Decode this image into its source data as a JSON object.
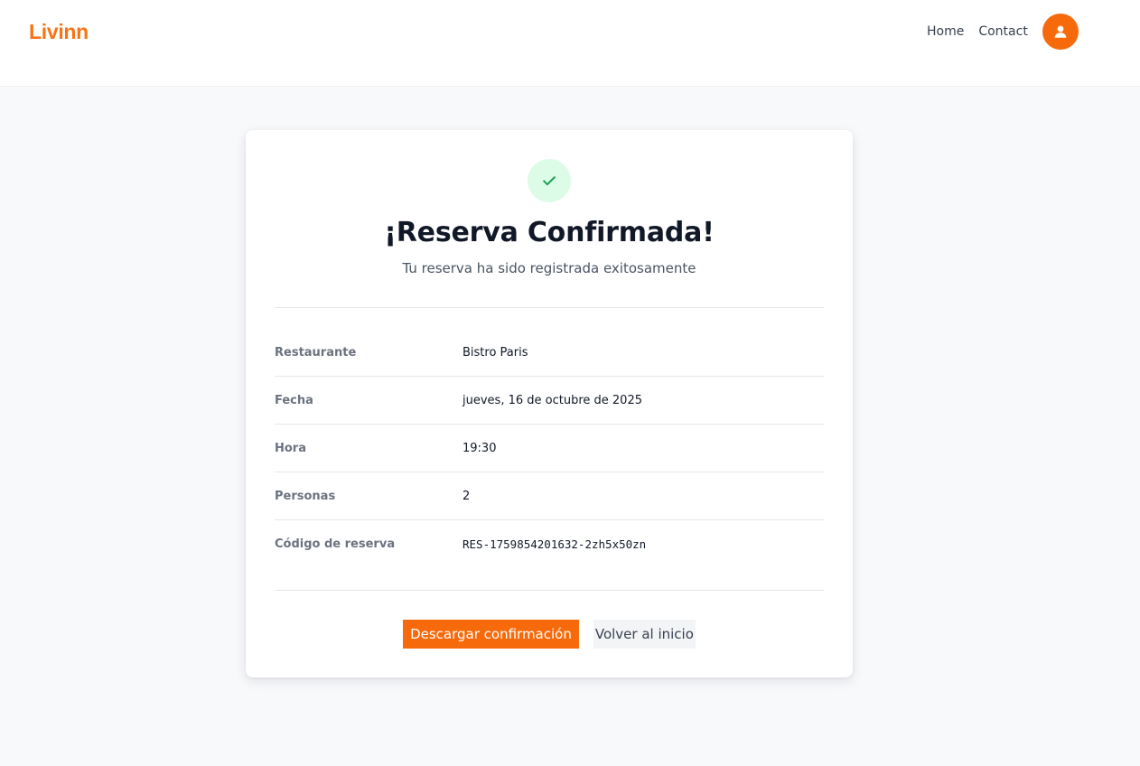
{
  "colors": {
    "brand": "#f97316",
    "primary_button": "#f76a0b",
    "success_bg": "#dcfce7",
    "success_icon": "#16a34a"
  },
  "header": {
    "logo": "Livinn",
    "nav": [
      {
        "label": "Home"
      },
      {
        "label": "Contact"
      }
    ],
    "avatar_icon": "user-icon"
  },
  "confirmation": {
    "icon": "check-icon",
    "title": "¡Reserva Confirmada!",
    "subtitle": "Tu reserva ha sido registrada exitosamente",
    "details": [
      {
        "label": "Restaurante",
        "value": "Bistro Paris"
      },
      {
        "label": "Fecha",
        "value": "jueves, 16 de octubre de 2025"
      },
      {
        "label": "Hora",
        "value": "19:30"
      },
      {
        "label": "Personas",
        "value": "2"
      },
      {
        "label": "Código de reserva",
        "value": "RES-1759854201632-2zh5x50zn"
      }
    ],
    "actions": {
      "download_label": "Descargar confirmación",
      "home_label": "Volver al inicio"
    }
  }
}
